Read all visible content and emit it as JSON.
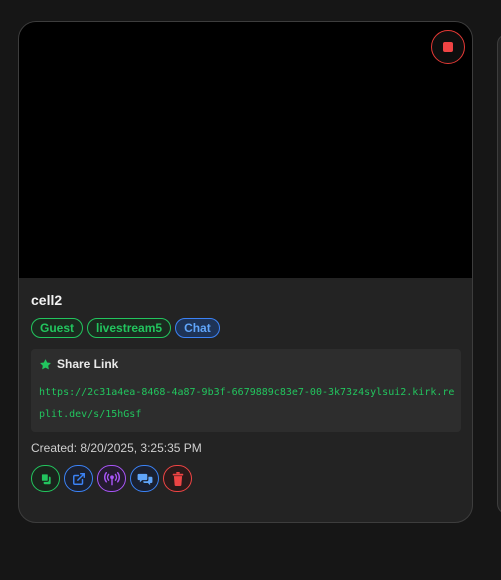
{
  "card": {
    "title": "cell2",
    "tags": [
      {
        "label": "Guest",
        "style": "green"
      },
      {
        "label": "livestream5",
        "style": "green"
      },
      {
        "label": "Chat",
        "style": "blue"
      }
    ],
    "share": {
      "heading": "Share Link",
      "url": "https://2c31a4ea-8468-4a87-9b3f-6679889c83e7-00-3k73z4sylsui2.kirk.replit.dev/s/15hGsf"
    },
    "created": "Created: 8/20/2025, 3:25:35 PM",
    "actions": [
      {
        "icon": "copy-icon",
        "color": "#22c55e"
      },
      {
        "icon": "external-link-icon",
        "color": "#3b82f6"
      },
      {
        "icon": "broadcast-icon",
        "color": "#a855f7"
      },
      {
        "icon": "chat-icon",
        "color": "#3b82f6"
      },
      {
        "icon": "trash-icon",
        "color": "#ef4444"
      }
    ]
  },
  "colors": {
    "accent_green": "#22c55e",
    "accent_blue": "#3b82f6",
    "accent_purple": "#a855f7",
    "danger": "#ef4444"
  }
}
